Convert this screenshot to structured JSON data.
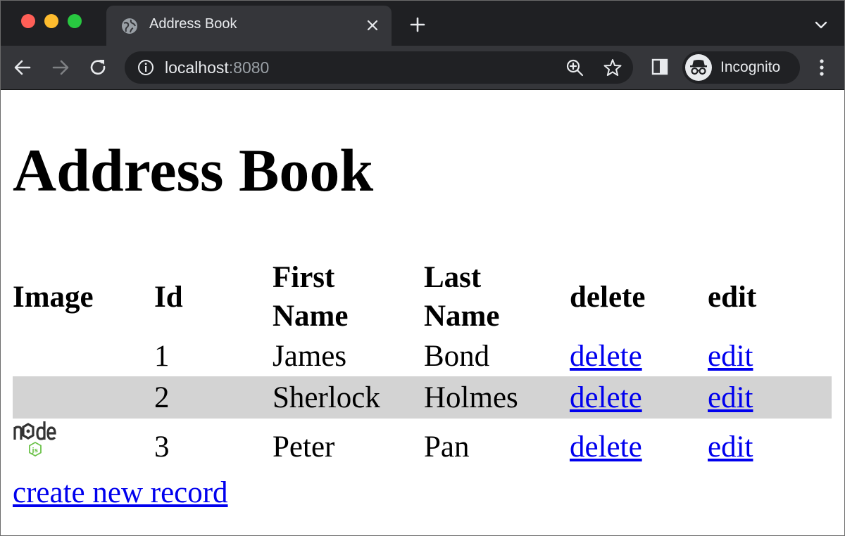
{
  "browser": {
    "tab": {
      "title": "Address Book",
      "icon": "globe-icon"
    },
    "address_bar": {
      "host": "localhost",
      "port": ":8080"
    },
    "profile": {
      "label": "Incognito",
      "icon": "incognito-icon"
    },
    "colors": {
      "frame": "#1f2023",
      "toolbar": "#35363a",
      "omnibox": "#202124",
      "text": "#e8eaed"
    }
  },
  "page": {
    "heading": "Address Book",
    "table": {
      "headers": {
        "image": "Image",
        "id": "Id",
        "first_name_line1": "First",
        "first_name_line2": "Name",
        "last_name_line1": "Last",
        "last_name_line2": "Name",
        "delete": "delete",
        "edit": "edit"
      },
      "rows": [
        {
          "image": "",
          "id": "1",
          "first": "James",
          "last": "Bond",
          "delete": "delete",
          "edit": "edit"
        },
        {
          "image": "",
          "id": "2",
          "first": "Sherlock",
          "last": "Holmes",
          "delete": "delete",
          "edit": "edit"
        },
        {
          "image": "node-js-logo",
          "id": "3",
          "first": "Peter",
          "last": "Pan",
          "delete": "delete",
          "edit": "edit"
        }
      ],
      "striped_row_color": "#d3d3d3"
    },
    "create_link": "create new record",
    "link_color": "#0000ee"
  }
}
